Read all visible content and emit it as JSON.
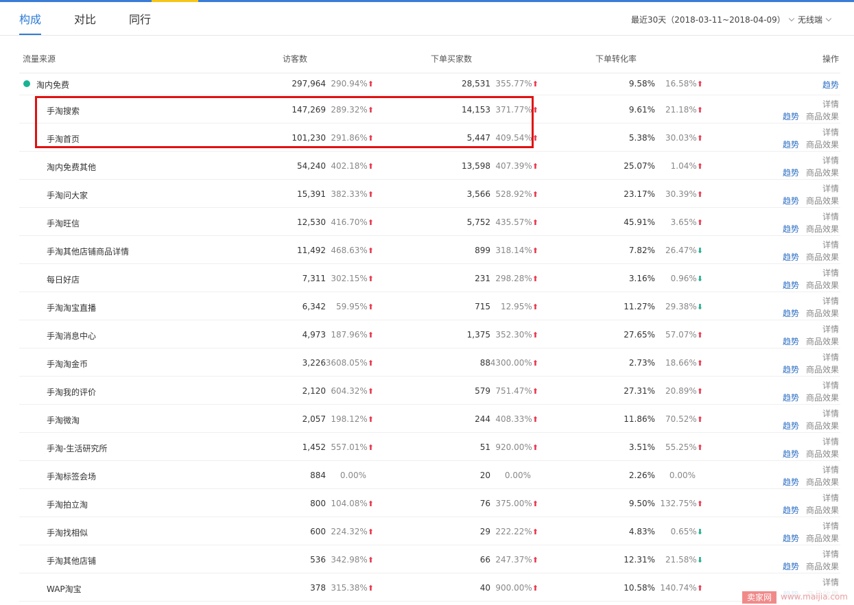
{
  "tabs": [
    "构成",
    "对比",
    "同行"
  ],
  "filters": {
    "date_range": "最近30天（2018-03-11~2018-04-09）",
    "device": "无线端"
  },
  "columns": {
    "source": "流量来源",
    "visitors": "访客数",
    "buyers": "下单买家数",
    "conversion": "下单转化率",
    "actions": "操作"
  },
  "action_labels": {
    "trend": "趋势",
    "detail": "详情",
    "product_effect": "商品效果"
  },
  "main_row": {
    "name": "淘内免费",
    "visitors": "297,964",
    "visitors_change": "290.94%",
    "visitors_dir": "up",
    "buyers": "28,531",
    "buyers_change": "355.77%",
    "buyers_dir": "up",
    "conversion": "9.58%",
    "conversion_change": "16.58%",
    "conversion_dir": "up"
  },
  "rows": [
    {
      "name": "手淘搜索",
      "visitors": "147,269",
      "visitors_change": "289.32%",
      "visitors_dir": "up",
      "buyers": "14,153",
      "buyers_change": "371.77%",
      "buyers_dir": "up",
      "conversion": "9.61%",
      "conversion_change": "21.18%",
      "conversion_dir": "up"
    },
    {
      "name": "手淘首页",
      "visitors": "101,230",
      "visitors_change": "291.86%",
      "visitors_dir": "up",
      "buyers": "5,447",
      "buyers_change": "409.54%",
      "buyers_dir": "up",
      "conversion": "5.38%",
      "conversion_change": "30.03%",
      "conversion_dir": "up"
    },
    {
      "name": "淘内免费其他",
      "visitors": "54,240",
      "visitors_change": "402.18%",
      "visitors_dir": "up",
      "buyers": "13,598",
      "buyers_change": "407.39%",
      "buyers_dir": "up",
      "conversion": "25.07%",
      "conversion_change": "1.04%",
      "conversion_dir": "up"
    },
    {
      "name": "手淘问大家",
      "visitors": "15,391",
      "visitors_change": "382.33%",
      "visitors_dir": "up",
      "buyers": "3,566",
      "buyers_change": "528.92%",
      "buyers_dir": "up",
      "conversion": "23.17%",
      "conversion_change": "30.39%",
      "conversion_dir": "up"
    },
    {
      "name": "手淘旺信",
      "visitors": "12,530",
      "visitors_change": "416.70%",
      "visitors_dir": "up",
      "buyers": "5,752",
      "buyers_change": "435.57%",
      "buyers_dir": "up",
      "conversion": "45.91%",
      "conversion_change": "3.65%",
      "conversion_dir": "up"
    },
    {
      "name": "手淘其他店铺商品详情",
      "visitors": "11,492",
      "visitors_change": "468.63%",
      "visitors_dir": "up",
      "buyers": "899",
      "buyers_change": "318.14%",
      "buyers_dir": "up",
      "conversion": "7.82%",
      "conversion_change": "26.47%",
      "conversion_dir": "down"
    },
    {
      "name": "每日好店",
      "visitors": "7,311",
      "visitors_change": "302.15%",
      "visitors_dir": "up",
      "buyers": "231",
      "buyers_change": "298.28%",
      "buyers_dir": "up",
      "conversion": "3.16%",
      "conversion_change": "0.96%",
      "conversion_dir": "down"
    },
    {
      "name": "手淘淘宝直播",
      "visitors": "6,342",
      "visitors_change": "59.95%",
      "visitors_dir": "up",
      "buyers": "715",
      "buyers_change": "12.95%",
      "buyers_dir": "up",
      "conversion": "11.27%",
      "conversion_change": "29.38%",
      "conversion_dir": "down"
    },
    {
      "name": "手淘消息中心",
      "visitors": "4,973",
      "visitors_change": "187.96%",
      "visitors_dir": "up",
      "buyers": "1,375",
      "buyers_change": "352.30%",
      "buyers_dir": "up",
      "conversion": "27.65%",
      "conversion_change": "57.07%",
      "conversion_dir": "up"
    },
    {
      "name": "手淘淘金币",
      "visitors": "3,226",
      "visitors_change": "3608.05%",
      "visitors_dir": "up",
      "buyers": "88",
      "buyers_change": "4300.00%",
      "buyers_dir": "up",
      "conversion": "2.73%",
      "conversion_change": "18.66%",
      "conversion_dir": "up"
    },
    {
      "name": "手淘我的评价",
      "visitors": "2,120",
      "visitors_change": "604.32%",
      "visitors_dir": "up",
      "buyers": "579",
      "buyers_change": "751.47%",
      "buyers_dir": "up",
      "conversion": "27.31%",
      "conversion_change": "20.89%",
      "conversion_dir": "up"
    },
    {
      "name": "手淘微淘",
      "visitors": "2,057",
      "visitors_change": "198.12%",
      "visitors_dir": "up",
      "buyers": "244",
      "buyers_change": "408.33%",
      "buyers_dir": "up",
      "conversion": "11.86%",
      "conversion_change": "70.52%",
      "conversion_dir": "up"
    },
    {
      "name": "手淘-生活研究所",
      "visitors": "1,452",
      "visitors_change": "557.01%",
      "visitors_dir": "up",
      "buyers": "51",
      "buyers_change": "920.00%",
      "buyers_dir": "up",
      "conversion": "3.51%",
      "conversion_change": "55.25%",
      "conversion_dir": "up"
    },
    {
      "name": "手淘标签会场",
      "visitors": "884",
      "visitors_change": "0.00%",
      "visitors_dir": "none",
      "buyers": "20",
      "buyers_change": "0.00%",
      "buyers_dir": "none",
      "conversion": "2.26%",
      "conversion_change": "0.00%",
      "conversion_dir": "none"
    },
    {
      "name": "手淘拍立淘",
      "visitors": "800",
      "visitors_change": "104.08%",
      "visitors_dir": "up",
      "buyers": "76",
      "buyers_change": "375.00%",
      "buyers_dir": "up",
      "conversion": "9.50%",
      "conversion_change": "132.75%",
      "conversion_dir": "up"
    },
    {
      "name": "手淘找相似",
      "visitors": "600",
      "visitors_change": "224.32%",
      "visitors_dir": "up",
      "buyers": "29",
      "buyers_change": "222.22%",
      "buyers_dir": "up",
      "conversion": "4.83%",
      "conversion_change": "0.65%",
      "conversion_dir": "down"
    },
    {
      "name": "手淘其他店铺",
      "visitors": "536",
      "visitors_change": "342.98%",
      "visitors_dir": "up",
      "buyers": "66",
      "buyers_change": "247.37%",
      "buyers_dir": "up",
      "conversion": "12.31%",
      "conversion_change": "21.58%",
      "conversion_dir": "down"
    },
    {
      "name": "WAP淘宝",
      "visitors": "378",
      "visitors_change": "315.38%",
      "visitors_dir": "up",
      "buyers": "40",
      "buyers_change": "900.00%",
      "buyers_dir": "up",
      "conversion": "10.58%",
      "conversion_change": "140.74%",
      "conversion_dir": "up"
    }
  ],
  "watermark": {
    "brand": "卖家网",
    "url": "www.maijia.com"
  }
}
